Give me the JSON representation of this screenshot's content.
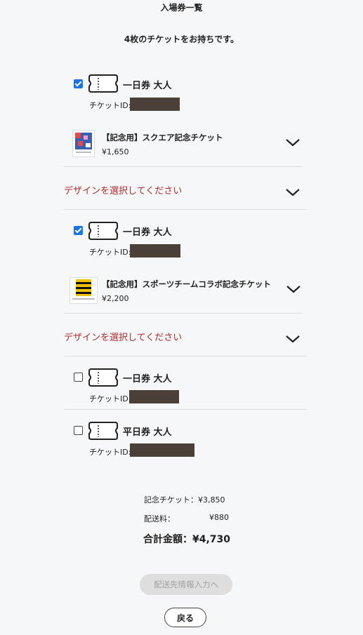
{
  "header": {
    "title": "入場券一覧",
    "ticket_count_text": "4枚のチケットをお持ちです。"
  },
  "tickets": [
    {
      "checked": true,
      "name": "一日券 大人",
      "id_label": "チケットID:",
      "product": {
        "name": "【記念用】スクエア記念チケット",
        "price": "¥1,650"
      },
      "design_prompt": "デザインを選択してください"
    },
    {
      "checked": true,
      "name": "一日券 大人",
      "id_label": "チケットID:",
      "product": {
        "name": "【記念用】スポーツチームコラボ記念チケット",
        "price": "¥2,200"
      },
      "design_prompt": "デザインを選択してください"
    },
    {
      "checked": false,
      "name": "一日券 大人",
      "id_label": "チケットID:"
    },
    {
      "checked": false,
      "name": "平日券 大人",
      "id_label": "チケットID:"
    }
  ],
  "summary": {
    "commemorative": "記念チケット：¥3,850",
    "shipping_label": "配送料：",
    "shipping_value": "¥880",
    "total": "合計金額：¥4,730"
  },
  "buttons": {
    "next": "配送先情報入力へ",
    "back": "戻る"
  },
  "colors": {
    "accent": "#1a73e8",
    "design_prompt": "#b02a2a",
    "background": "#f6f7f9"
  }
}
